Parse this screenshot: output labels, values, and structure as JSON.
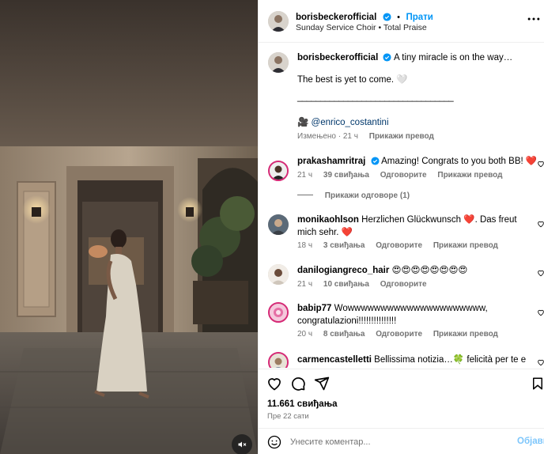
{
  "post": {
    "author": "borisbeckerofficial",
    "follow_label": "Прати",
    "dot": "•",
    "audio": "Sunday Service Choir • Total Praise",
    "more_icon": "more-options-icon"
  },
  "caption": {
    "author": "borisbeckerofficial",
    "line1": "A tiny miracle is on the way…",
    "line2": "The best is yet to come. 🤍",
    "rule": "__________________________________",
    "credit_emoji": "🎥",
    "credit": "@enrico_costantini",
    "time": "Измењено · 21 ч",
    "translate": "Прикажи превод"
  },
  "comments": [
    {
      "user": "prakashamritraj",
      "verified": true,
      "text": "Amazing! Congrats to you both BB! ❤️",
      "time": "21 ч",
      "likes": "39 свиђања",
      "reply": "Одговорите",
      "translate": "Прикажи превод",
      "view_replies": "Прикажи одговоре (1)"
    },
    {
      "user": "monikaohlson",
      "verified": false,
      "text": "Herzlichen Glückwunsch ❤️. Das freut mich sehr. ❤️",
      "time": "18 ч",
      "likes": "3 свиђања",
      "reply": "Одговорите",
      "translate": "Прикажи превод"
    },
    {
      "user": "danilogiangreco_hair",
      "verified": false,
      "text": "😍😍😍😍😍😍😍😍",
      "time": "21 ч",
      "likes": "10 свиђања",
      "reply": "Одговорите",
      "translate": ""
    },
    {
      "user": "babip77",
      "verified": false,
      "text": "Wowwwwwwwwwwwwwwwwwwwww, congratulazioni!!!!!!!!!!!!!!!",
      "time": "20 ч",
      "likes": "8 свиђања",
      "reply": "Одговорите",
      "translate": "Прикажи превод"
    },
    {
      "user": "carmencastelletti",
      "verified": false,
      "text": "Bellissima notizia…🍀 felicità per te e",
      "time": "",
      "likes": "",
      "reply": "",
      "translate": ""
    }
  ],
  "footer": {
    "likes": "11.661 свиђања",
    "time": "Пре 22 сати",
    "comment_placeholder": "Унесите коментар...",
    "post_label": "Објави"
  },
  "colors": {
    "accent": "#0095f6",
    "heart": "#ff3040",
    "muted": "#737373",
    "divider": "#efefef",
    "post_disabled": "#7dc6fb"
  }
}
